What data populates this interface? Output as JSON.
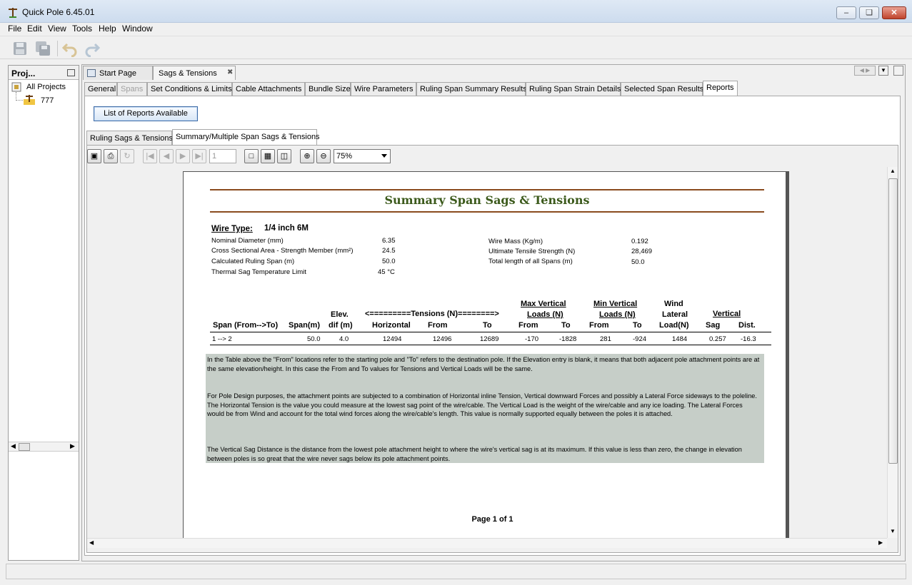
{
  "window": {
    "title": "Quick Pole 6.45.01"
  },
  "menu": [
    "File",
    "Edit",
    "View",
    "Tools",
    "Help",
    "Window"
  ],
  "left_panel": {
    "title": "Proj...",
    "tree": [
      {
        "label": "All Projects"
      },
      {
        "label": "777"
      }
    ]
  },
  "doc_tabs": [
    {
      "label": "Start Page"
    },
    {
      "label": "Sags & Tensions"
    }
  ],
  "sub_tabs": [
    {
      "label": "General"
    },
    {
      "label": "Spans"
    },
    {
      "label": "Set Conditions & Limits"
    },
    {
      "label": "Cable Attachments"
    },
    {
      "label": "Bundle Size"
    },
    {
      "label": "Wire Parameters"
    },
    {
      "label": "Ruling Span Summary Results"
    },
    {
      "label": "Ruling Span Strain Details"
    },
    {
      "label": "Selected Span Results"
    },
    {
      "label": "Reports"
    }
  ],
  "reports_button": "List of Reports Available",
  "report_tabs": [
    {
      "label": "Ruling Sags & Tensions"
    },
    {
      "label": "Summary/Multiple Span Sags & Tensions"
    }
  ],
  "viewer": {
    "page_number": "1",
    "zoom": "75%",
    "footer": "Page 1 of 1"
  },
  "report": {
    "title": "Summary Span Sags & Tensions",
    "wire_type_label": "Wire Type:",
    "wire_type_value": "1/4 inch 6M",
    "props_left": [
      {
        "label": "Nominal Diameter (mm)",
        "value": "6.35"
      },
      {
        "label": "Cross Sectional Area - Strength Member (mm²)",
        "value": "24.5"
      },
      {
        "label": "Calculated Ruling Span (m)",
        "value": "50.0"
      },
      {
        "label": "Thermal Sag Temperature Limit",
        "value": "45 °C"
      }
    ],
    "props_right": [
      {
        "label": "Wire Mass (Kg/m)",
        "value": "0.192"
      },
      {
        "label": "Ultimate Tensile Strength (N)",
        "value": "28,469"
      },
      {
        "label": "Total length of all Spans (m)",
        "value": "50.0"
      }
    ],
    "table": {
      "group_headers": {
        "elev": "Elev.",
        "tensions": "<=========Tensions (N)========>",
        "max_vert_1": "Max Vertical",
        "max_vert_2": "Loads (N)",
        "min_vert_1": "Min Vertical",
        "min_vert_2": "Loads (N)",
        "wind_1": "Wind",
        "wind_2": "Lateral",
        "vertical": "Vertical"
      },
      "columns": [
        "Span (From-->To)",
        "Span(m)",
        "dif (m)",
        "Horizontal",
        "From",
        "To",
        "From",
        "To",
        "From",
        "To",
        "Load(N)",
        "Sag",
        "Dist."
      ],
      "rows": [
        [
          "1 --> 2",
          "50.0",
          "4.0",
          "12494",
          "12496",
          "12689",
          "-170",
          "-1828",
          "281",
          "-924",
          "1484",
          "0.257",
          "-16.3"
        ]
      ]
    },
    "notes": [
      "In the Table above the \"From\" locations refer to the starting pole and \"To\" refers to the destination pole. If the Elevation entry is blank, it means that both adjacent pole attachment points are at the same elevation/height. In this case the From and To values for Tensions and Vertical Loads will be the same.",
      "For Pole Design purposes, the attachment points are subjected to a combination of Horizontal inline Tension, Vertical downward Forces and possibly a Lateral Force sideways to the poleline. The Horizontal Tension is the value you could measure at the lowest sag point of the wire/cable. The Vertical Load is the weight of the wire/cable and any ice loading. The Lateral Forces would be from Wind and account for the total wind forces along the wire/cable's length. This value is normally supported equally between the poles it is attached.",
      "The Vertical Sag Distance is the distance from the lowest pole attachment height to where the wire's vertical sag is at its maximum. If this value is less than zero, the change in elevation between poles is so great that the wire never sags below its pole attachment points."
    ]
  }
}
